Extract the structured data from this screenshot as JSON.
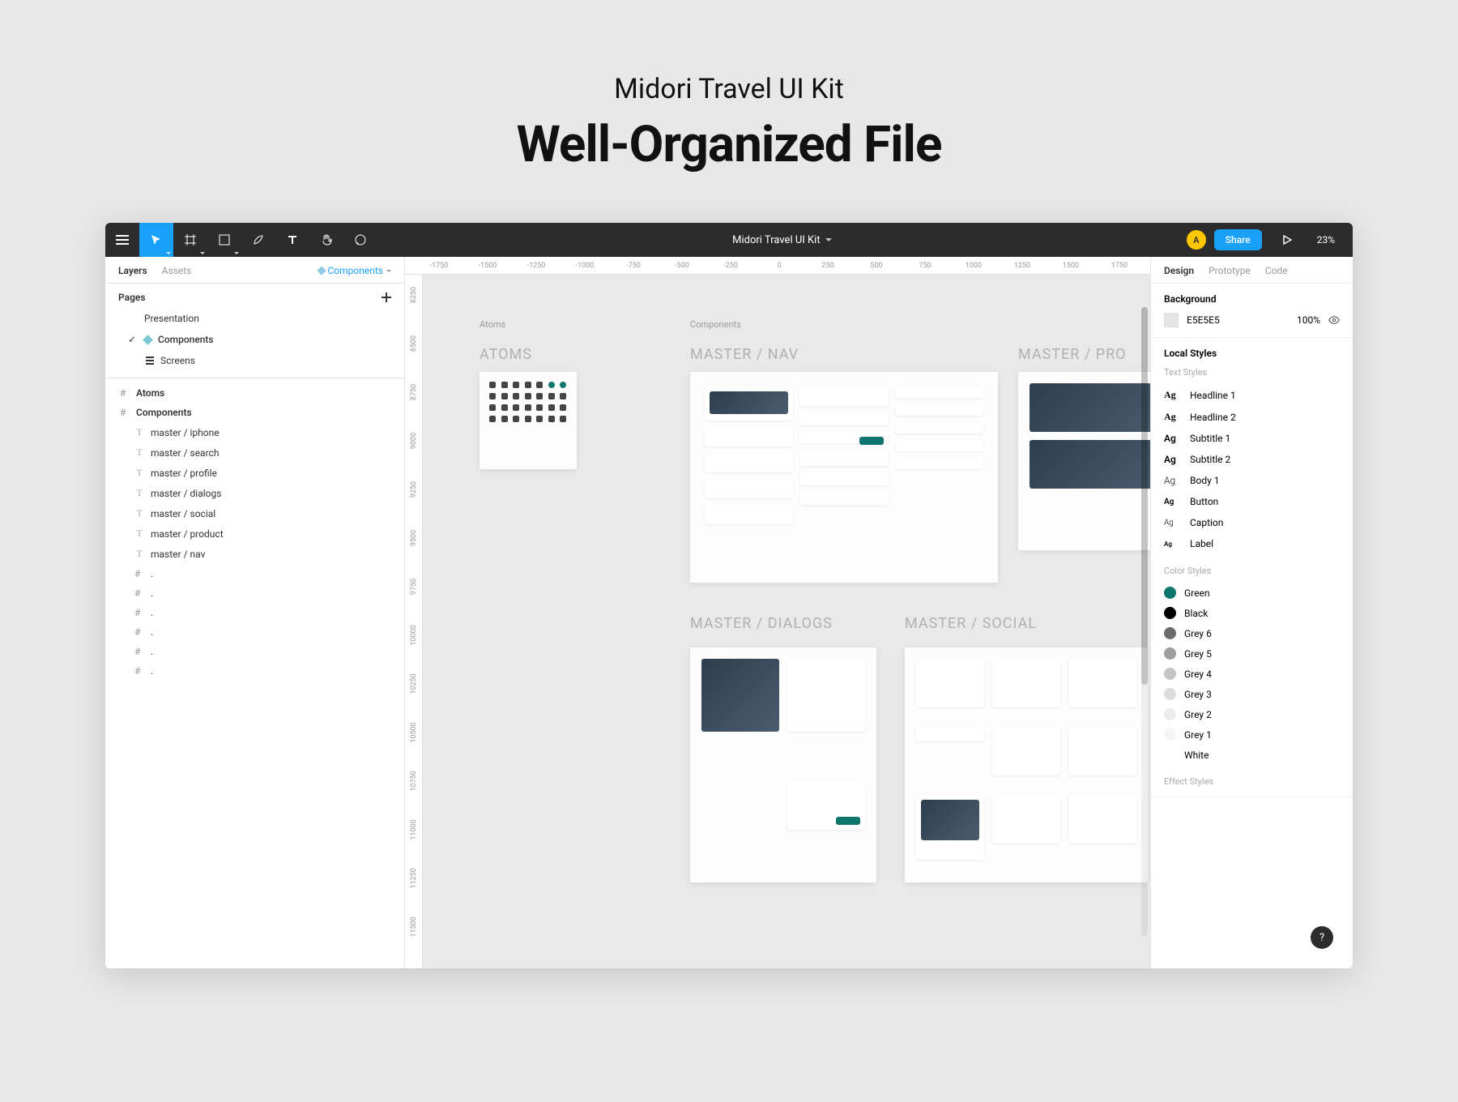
{
  "hero": {
    "subtitle": "Midori Travel UI Kit",
    "title": "Well-Organized File"
  },
  "toolbar": {
    "file_name": "Midori Travel UI Kit",
    "avatar_initial": "A",
    "share_label": "Share",
    "zoom": "23%"
  },
  "left_panel": {
    "tabs": {
      "layers": "Layers",
      "assets": "Assets"
    },
    "filter_label": "Components",
    "pages_title": "Pages",
    "pages": [
      {
        "name": "Presentation",
        "active": false,
        "icon": "none"
      },
      {
        "name": "Components",
        "active": true,
        "icon": "component"
      },
      {
        "name": "Screens",
        "active": false,
        "icon": "frame"
      }
    ],
    "layer_frames": [
      {
        "name": "Atoms",
        "bold": true
      },
      {
        "name": "Components",
        "bold": true
      }
    ],
    "sublayers": [
      "master / iphone",
      "master / search",
      "master / profile",
      "master / dialogs",
      "master / social",
      "master / product",
      "master / nav"
    ],
    "dot_rows": [
      ".",
      ".",
      ".",
      ".",
      ".",
      "."
    ]
  },
  "ruler": {
    "top": [
      "-1750",
      "-1500",
      "-1250",
      "-1000",
      "-750",
      "-500",
      "-250",
      "0",
      "250",
      "500",
      "750",
      "1000",
      "1250",
      "1500",
      "1750"
    ],
    "left": [
      "8250",
      "8500",
      "8750",
      "9000",
      "9250",
      "9500",
      "9750",
      "10000",
      "10250",
      "10500",
      "10750",
      "11000",
      "11250",
      "11500"
    ]
  },
  "canvas": {
    "atoms_label": "Atoms",
    "atoms_title": "ATOMS",
    "components_label": "Components",
    "nav_title": "MASTER / NAV",
    "pro_title": "MASTER / PRO",
    "dialogs_title": "MASTER / DIALOGS",
    "social_title": "MASTER / SOCIAL"
  },
  "right_panel": {
    "tabs": {
      "design": "Design",
      "prototype": "Prototype",
      "code": "Code"
    },
    "bg_title": "Background",
    "bg_value": "E5E5E5",
    "bg_opacity": "100%",
    "local_styles": "Local Styles",
    "text_styles": "Text Styles",
    "text_list": [
      "Headline 1",
      "Headline 2",
      "Subtitle 1",
      "Subtitle 2",
      "Body 1",
      "Button",
      "Caption",
      "Label"
    ],
    "color_styles": "Color Styles",
    "colors": [
      {
        "name": "Green",
        "hex": "#0f766e"
      },
      {
        "name": "Black",
        "hex": "#000000"
      },
      {
        "name": "Grey 6",
        "hex": "#6b6b6b"
      },
      {
        "name": "Grey 5",
        "hex": "#9e9e9e"
      },
      {
        "name": "Grey 4",
        "hex": "#c4c4c4"
      },
      {
        "name": "Grey 3",
        "hex": "#dcdcdc"
      },
      {
        "name": "Grey 2",
        "hex": "#ececec"
      },
      {
        "name": "Grey 1",
        "hex": "#f5f5f5"
      },
      {
        "name": "White",
        "hex": "#ffffff"
      }
    ],
    "effect_styles": "Effect Styles",
    "help": "?"
  }
}
